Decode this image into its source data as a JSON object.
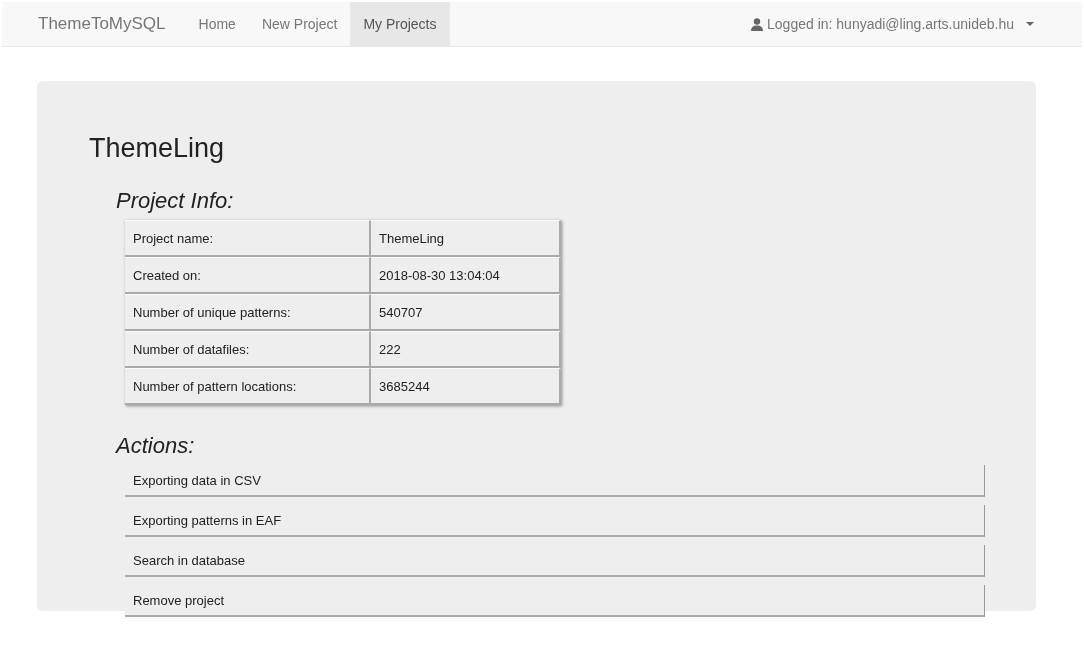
{
  "navbar": {
    "brand": "ThemeToMySQL",
    "links": [
      {
        "label": "Home",
        "selected": false
      },
      {
        "label": "New Project",
        "selected": false
      },
      {
        "label": "My Projects",
        "selected": true
      }
    ],
    "user": "Logged in: hunyadi@ling.arts.unideb.hu"
  },
  "project": {
    "title": "ThemeLing",
    "info_heading": "Project Info:",
    "info": [
      {
        "label": "Project name:",
        "value": "ThemeLing"
      },
      {
        "label": "Created on:",
        "value": "2018-08-30 13:04:04"
      },
      {
        "label": "Number of unique patterns:",
        "value": "540707"
      },
      {
        "label": "Number of datafiles:",
        "value": "222"
      },
      {
        "label": "Number of pattern locations:",
        "value": "3685244"
      }
    ],
    "actions_heading": "Actions:",
    "actions": [
      "Exporting data in CSV",
      "Exporting patterns in EAF",
      "Search in database",
      "Remove project"
    ]
  }
}
